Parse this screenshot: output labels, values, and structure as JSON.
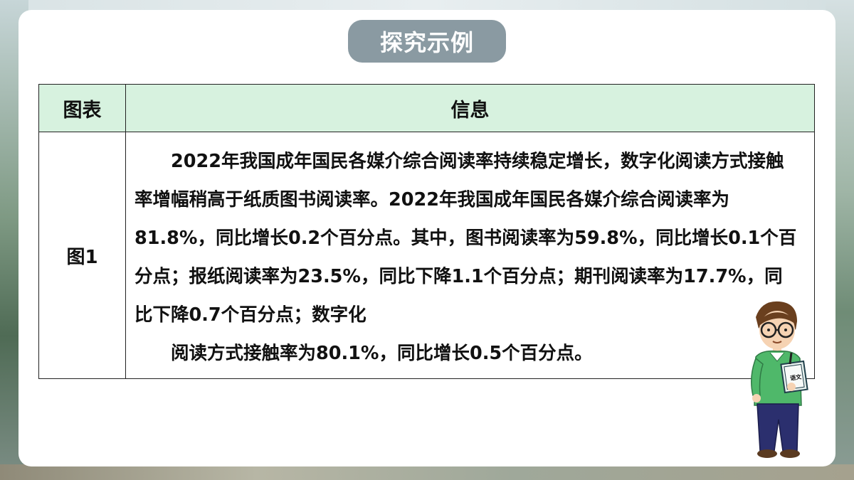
{
  "slide": {
    "title": "探究示例"
  },
  "table": {
    "headers": [
      "图表",
      "信息"
    ],
    "rows": [
      {
        "label": "图1",
        "paragraph1": "2022年我国成年国民各媒介综合阅读率持续稳定增长，数字化阅读方式接触率增幅稍高于纸质图书阅读率。2022年我国成年国民各媒介综合阅读率为81.8%，同比增长0.2个百分点。其中，图书阅读率为59.8%，同比增长0.1个百分点；报纸阅读率为23.5%，同比下降1.1个百分点；期刊阅读率为17.7%，同比下降0.7个百分点；数字化",
        "paragraph2": "阅读方式接触率为80.1%，同比增长0.5个百分点。"
      }
    ]
  },
  "book_label": "语文",
  "colors": {
    "title_pill": "#8a9aa2",
    "header_bg": "#d7f2df",
    "shirt": "#4fb86a",
    "pants": "#2b2f6e"
  },
  "icons": {
    "character": "student-with-book-illustration"
  }
}
